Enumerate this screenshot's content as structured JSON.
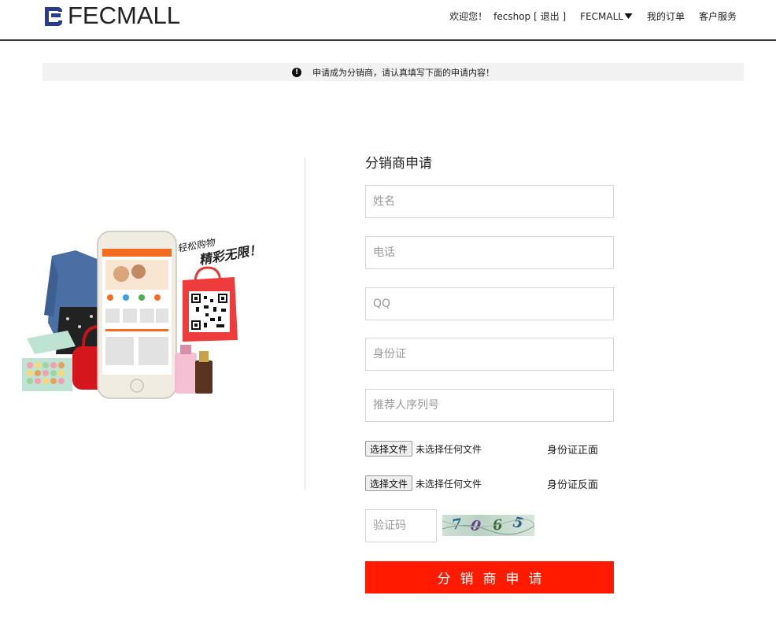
{
  "brand": {
    "name": "FECMALL",
    "accent": "#2a3b8f"
  },
  "header": {
    "welcome": "欢迎您！",
    "username": "fecshop",
    "logout": "[ 退出 ]",
    "menu_label": "FECMALL",
    "my_orders": "我的订单",
    "customer_service": "客户服务"
  },
  "notice": {
    "icon": "exclamation-icon",
    "text": "申请成为分销商，请认真填写下面的申请内容！"
  },
  "promo": {
    "slogan_line1": "轻松购物",
    "slogan_line2": "精彩无限！"
  },
  "form": {
    "title": "分销商申请",
    "name_placeholder": "姓名",
    "phone_placeholder": "电话",
    "qq_placeholder": "QQ",
    "id_placeholder": "身份证",
    "referrer_placeholder": "推荐人序列号",
    "file_button": "选择文件",
    "file_status": "未选择任何文件",
    "id_front_label": "身份证正面",
    "id_back_label": "身份证反面",
    "captcha_placeholder": "验证码",
    "captcha_text": "7065",
    "submit_label": "分销商申请",
    "submit_color": "#ff1a00"
  }
}
